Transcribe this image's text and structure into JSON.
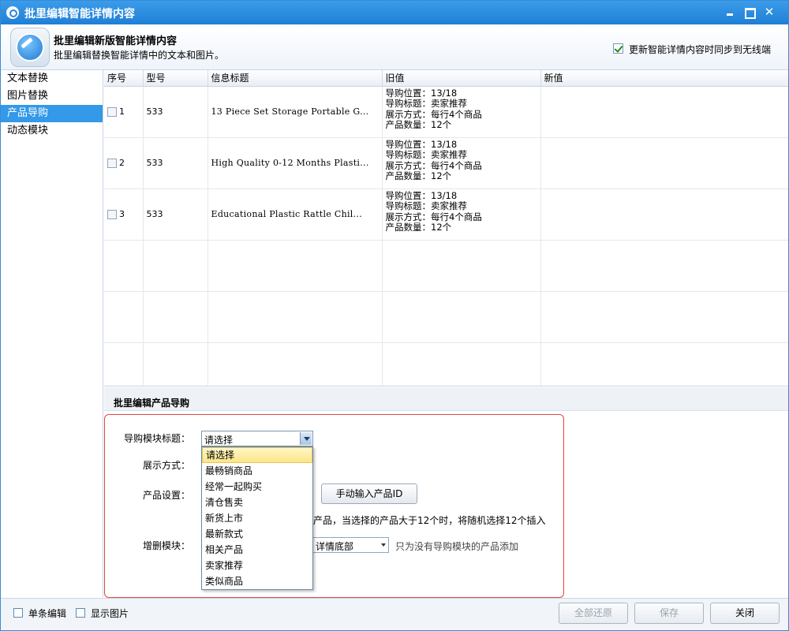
{
  "window": {
    "title": "批里编辑智能详情内容"
  },
  "header": {
    "title": "批里编辑新版智能详情内容",
    "subtitle": "批里编辑替换智能详情中的文本和图片。",
    "sync_label": "更新智能详情内容时同步到无线端",
    "sync_checked": true
  },
  "sidebar": {
    "items": [
      {
        "label": "文本替换"
      },
      {
        "label": "图片替换"
      },
      {
        "label": "产品导购",
        "active": true
      },
      {
        "label": "动态模块"
      }
    ]
  },
  "table": {
    "columns": [
      "序号",
      "型号",
      "信息标题",
      "旧值",
      "新值"
    ],
    "rows": [
      {
        "index": "1",
        "model": "533",
        "title": "13 Piece Set Storage Portable G...",
        "old": [
          "导购位置：13/18",
          "导购标题：卖家推荐",
          "展示方式：每行4个商品",
          "产品数量：12个"
        ],
        "new": ""
      },
      {
        "index": "2",
        "model": "533",
        "title": "High Quality 0-12 Months Plasti...",
        "old": [
          "导购位置：13/18",
          "导购标题：卖家推荐",
          "展示方式：每行4个商品",
          "产品数量：12个"
        ],
        "new": ""
      },
      {
        "index": "3",
        "model": "533",
        "title": "Educational Plastic Rattle Chil...",
        "old": [
          "导购位置：13/18",
          "导购标题：卖家推荐",
          "展示方式：每行4个商品",
          "产品数量：12个"
        ],
        "new": ""
      }
    ]
  },
  "module": {
    "section_title": "批里编辑产品导购",
    "title_label": "导购模块标题：",
    "title_value": "请选择",
    "display_label": "展示方式：",
    "product_label": "产品设置：",
    "manual_id_button": "手动输入产品ID",
    "product_note": "产品，当选择的产品大于12个时，将随机选择12个插入",
    "modify_label": "增删模块：",
    "position_value": "详情底部",
    "position_note": "只为没有导购模块的产品添加",
    "dropdown_options": [
      "请选择",
      "最畅销商品",
      "经常一起购买",
      "清仓售卖",
      "新货上市",
      "最新款式",
      "相关产品",
      "卖家推荐",
      "类似商品"
    ]
  },
  "footer": {
    "single_edit_label": "单条编辑",
    "show_images_label": "显示图片",
    "restore_all": "全部还原",
    "save": "保存",
    "close": "关闭"
  }
}
